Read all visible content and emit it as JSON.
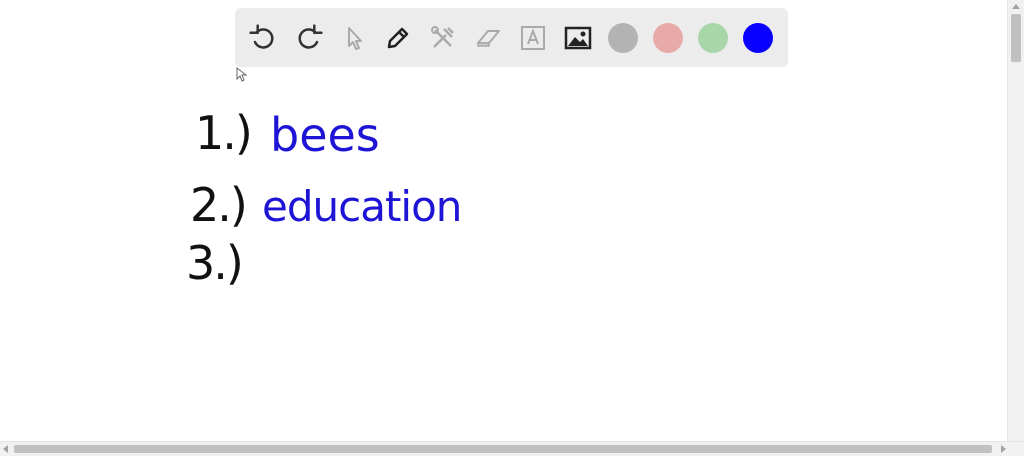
{
  "toolbar": {
    "tools": [
      {
        "name": "undo",
        "icon": "undo-icon"
      },
      {
        "name": "redo",
        "icon": "redo-icon"
      },
      {
        "name": "select",
        "icon": "pointer-icon"
      },
      {
        "name": "pen",
        "icon": "pencil-icon"
      },
      {
        "name": "tools",
        "icon": "tools-icon"
      },
      {
        "name": "eraser",
        "icon": "eraser-icon"
      },
      {
        "name": "text",
        "icon": "text-box-icon"
      },
      {
        "name": "image",
        "icon": "image-icon"
      }
    ],
    "colors": [
      "#b3b3b3",
      "#e8a9a9",
      "#a9d6a9",
      "#0a00ff"
    ],
    "selected_color": "#0a00ff"
  },
  "canvas": {
    "ink_black": "#111111",
    "ink_blue": "#1e14d6",
    "items": [
      {
        "number": "1.)",
        "answer": "bees"
      },
      {
        "number": "2.)",
        "answer": "education"
      },
      {
        "number": "3.)",
        "answer": ""
      }
    ]
  }
}
